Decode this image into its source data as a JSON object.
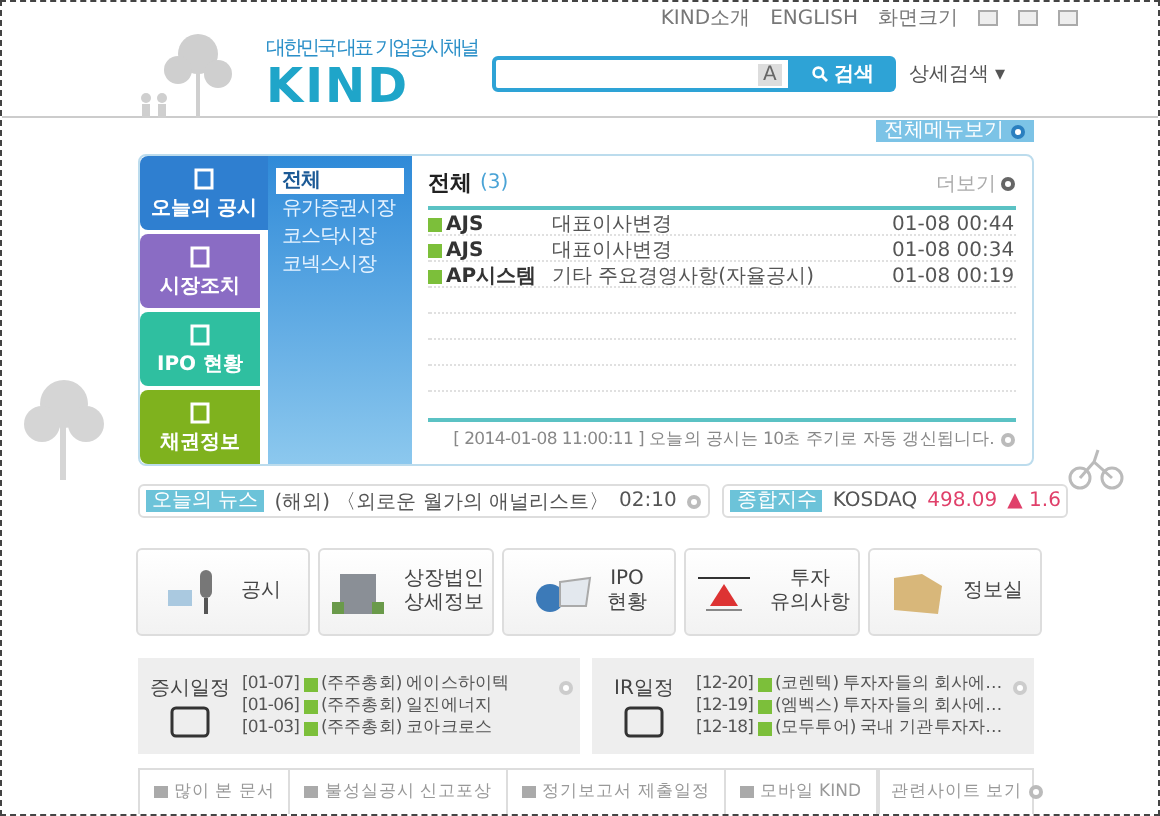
{
  "top_links": [
    "KIND소개",
    "ENGLISH"
  ],
  "screen_size": {
    "label": "화면크기"
  },
  "logo": {
    "tagline": "대한민국 대표 기업공시채널",
    "name": "KIND"
  },
  "search": {
    "select": "A",
    "button": "검색",
    "detail": "상세검색 ▾"
  },
  "all_menu": {
    "label": "전체메뉴보기"
  },
  "side_tabs": [
    {
      "label": "오늘의 공시",
      "selected": true,
      "color": "#2f7fd0"
    },
    {
      "label": "시장조치",
      "selected": false,
      "color": "#8a6cc4"
    },
    {
      "label": "IPO 현황",
      "selected": false,
      "color": "#2fbfa0"
    },
    {
      "label": "채권정보",
      "selected": false,
      "color": "#7fb21e"
    }
  ],
  "markets": [
    {
      "label": "전체",
      "selected": true
    },
    {
      "label": "유가증권시장",
      "selected": false
    },
    {
      "label": "코스닥시장",
      "selected": false
    },
    {
      "label": "코넥스시장",
      "selected": false
    }
  ],
  "disclosures": {
    "title": "전체",
    "count": "(3)",
    "more": "더보기",
    "rows": [
      {
        "company": "AJS",
        "title": "대표이사변경",
        "time": "01-08 00:44"
      },
      {
        "company": "AJS",
        "title": "대표이사변경",
        "time": "01-08 00:34"
      },
      {
        "company": "AP시스템",
        "title": "기타 주요경영사항(자율공시)",
        "time": "01-08 00:19"
      }
    ],
    "footer": "[ 2014-01-08 11:00:11 ] 오늘의 공시는 10초 주기로 자동 갱신됩니다."
  },
  "news": {
    "badge": "오늘의 뉴스",
    "headline": "(해외) 〈외로운 월가의 애널리스트〉",
    "time": "02:10"
  },
  "index": {
    "badge": "종합지수",
    "market": "KOSDAQ",
    "value": "498.09",
    "change": "▲ 1.6"
  },
  "quick_links": [
    {
      "lines": [
        "공시"
      ]
    },
    {
      "lines": [
        "상장법인",
        "상세정보"
      ]
    },
    {
      "lines": [
        "IPO",
        "현황"
      ]
    },
    {
      "lines": [
        "투자",
        "유의사항"
      ]
    },
    {
      "lines": [
        "정보실"
      ]
    }
  ],
  "schedules": [
    {
      "title": "증시일정",
      "items": [
        {
          "date": "[01-07]",
          "text": "(주주총회) 에이스하이텍"
        },
        {
          "date": "[01-06]",
          "text": "(주주총회) 일진에너지"
        },
        {
          "date": "[01-03]",
          "text": "(주주총회) 코아크로스"
        }
      ]
    },
    {
      "title": "IR일정",
      "items": [
        {
          "date": "[12-20]",
          "text": "(코렌텍) 투자자들의 회사에…"
        },
        {
          "date": "[12-19]",
          "text": "(엠벡스) 투자자들의 회사에…"
        },
        {
          "date": "[12-18]",
          "text": "(모두투어) 국내 기관투자자…"
        }
      ]
    }
  ],
  "bottom_links": [
    "많이 본 문서",
    "불성실공시 신고포상",
    "정기보고서 제출일정",
    "모바일 KIND"
  ],
  "related": {
    "label": "관련사이트 보기"
  }
}
